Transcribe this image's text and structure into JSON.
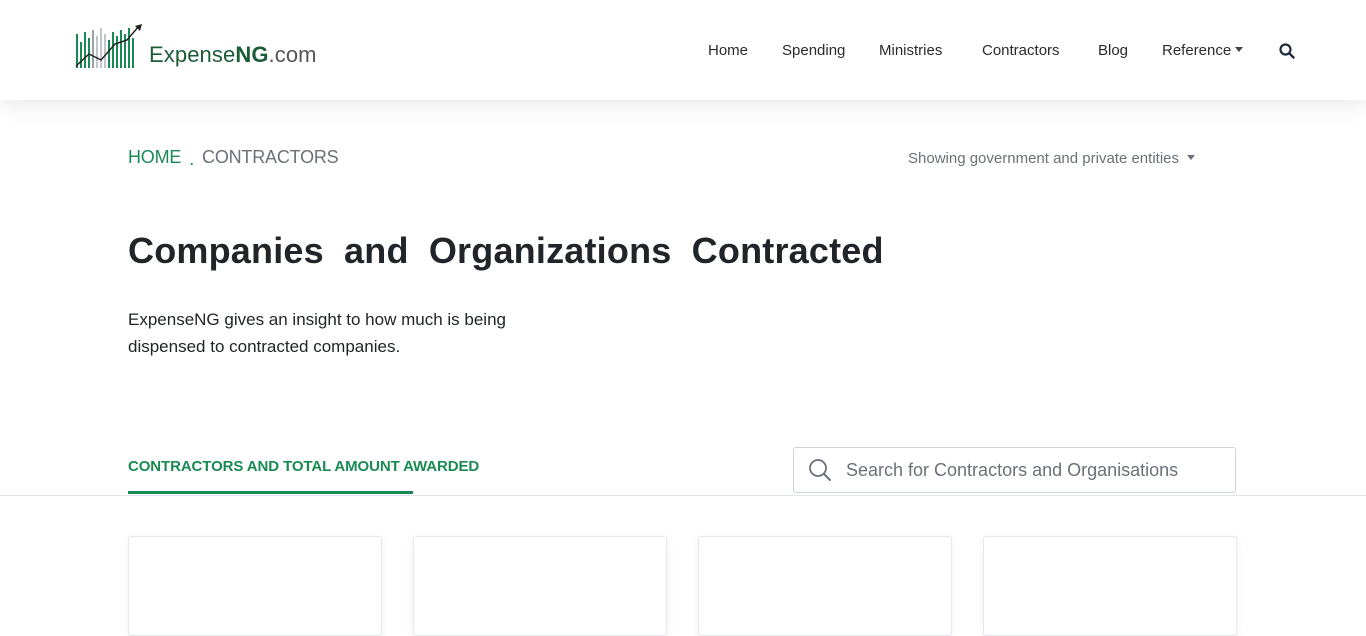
{
  "header": {
    "logo": {
      "name_part1": "Expense",
      "name_part2": "NG",
      "name_part3": ".com"
    },
    "nav": [
      {
        "label": "Home"
      },
      {
        "label": "Spending"
      },
      {
        "label": "Ministries"
      },
      {
        "label": "Contractors"
      },
      {
        "label": "Blog"
      },
      {
        "label": "Reference",
        "has_dropdown": true
      }
    ],
    "search_icon": "search-icon"
  },
  "breadcrumb": {
    "home": "HOME",
    "separator": ".",
    "current": "CONTRACTORS"
  },
  "filter": {
    "label": "Showing government and private entities"
  },
  "page": {
    "title": "Companies and Organizations Contracted",
    "description": "ExpenseNG gives an insight to how much is being dispensed to contracted companies."
  },
  "tabs": {
    "active": "CONTRACTORS AND TOTAL AMOUNT AWARDED"
  },
  "search": {
    "placeholder": "Search for Contractors and Organisations",
    "value": "",
    "icon": "search-icon"
  },
  "colors": {
    "brand_green": "#1a8a54",
    "logo_green": "#1a5c38",
    "muted_text": "#6b7079"
  }
}
